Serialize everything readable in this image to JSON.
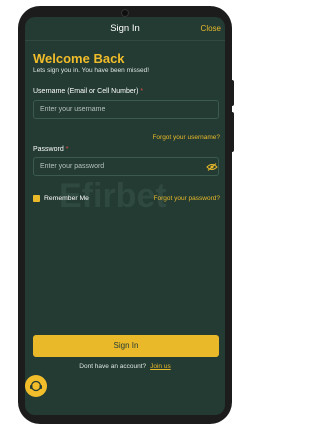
{
  "header": {
    "title": "Sign In",
    "close_label": "Close"
  },
  "welcome": {
    "title": "Welcome Back",
    "subtitle": "Lets sign you in. You have been missed!"
  },
  "username": {
    "label": "Username (Email or Cell Number)",
    "required_mark": "*",
    "placeholder": "Enter your username",
    "forgot_label": "Forgot your username?"
  },
  "password": {
    "label": "Password",
    "required_mark": "*",
    "placeholder": "Enter your password",
    "toggle_icon": "eye-slash-icon",
    "forgot_label": "Forgot your password?"
  },
  "remember": {
    "label": "Remember Me",
    "checked": true
  },
  "watermark": {
    "text": "Efirbet"
  },
  "actions": {
    "signin_label": "Sign In",
    "no_account_text": "Dont have an account?",
    "join_label": "Join us"
  },
  "colors": {
    "background": "#233b33",
    "accent": "#e9b92a",
    "required": "#e04b4b"
  },
  "chat": {
    "icon": "chat-support-icon"
  }
}
